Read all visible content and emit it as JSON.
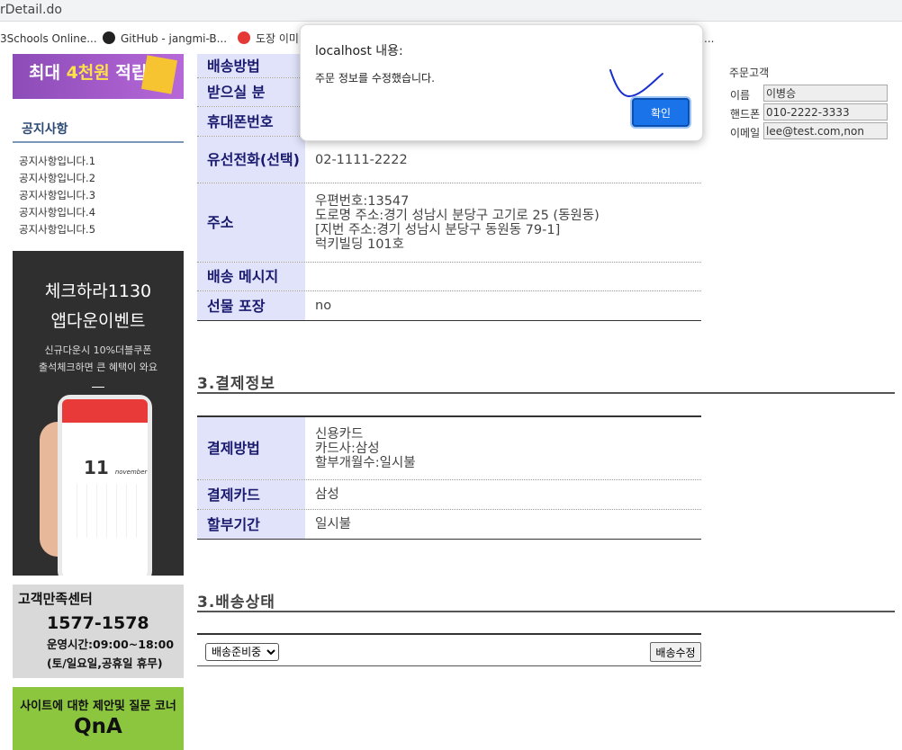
{
  "browser": {
    "url": "rDetail.do",
    "bookmarks": [
      {
        "label": "3Schools Online...",
        "icon": "w3schools-icon"
      },
      {
        "label": "GitHub - jangmi-B...",
        "icon": "github-icon"
      },
      {
        "label": "도장 이미",
        "icon": "stamp-icon"
      }
    ],
    "bookmark_trailing": "..."
  },
  "sidebar": {
    "top_banner": {
      "prefix": "최대 ",
      "highlight": "4천원",
      "suffix": " 적립!"
    },
    "notice": {
      "title": "공지사항",
      "items": [
        "공지사항입니다.1",
        "공지사항입니다.2",
        "공지사항입니다.3",
        "공지사항입니다.4",
        "공지사항입니다.5"
      ]
    },
    "app_banner": {
      "line1": "체크하라1130",
      "line2": "앱다운이벤트",
      "line3": "신규다운시 10%더블쿠폰",
      "line4": "출석체크하면 큰 혜택이 와요",
      "phone_day": "11",
      "phone_month": "november"
    },
    "customer_center": {
      "title": "고객만족센터",
      "phone": "1577-1578",
      "hours": "운영시간:09:00~18:00",
      "closed": "(토/일요일,공휴일 휴무)"
    },
    "qna": {
      "line1": "사이트에 대한 제안및 질문 코너",
      "line2": "QnA"
    }
  },
  "delivery_info": {
    "rows": [
      {
        "label": "배송방법",
        "lines": []
      },
      {
        "label": "받으실 분",
        "lines": []
      },
      {
        "label": "휴대폰번호",
        "lines": []
      },
      {
        "label": "유선전화(선택)",
        "lines": [
          "02-1111-2222"
        ]
      },
      {
        "label": "주소",
        "lines": [
          "우편번호:13547",
          "도로명 주소:경기 성남시 분당구 고기로 25 (동원동)",
          "[지번 주소:경기 성남시 분당구 동원동 79-1]",
          "럭키빌딩 101호"
        ]
      },
      {
        "label": "배송 메시지",
        "lines": []
      },
      {
        "label": "선물 포장",
        "lines": [
          "no"
        ]
      }
    ]
  },
  "payment": {
    "title": "3.결제정보",
    "rows": [
      {
        "label": "결제방법",
        "lines": [
          "신용카드",
          "카드사:삼성",
          "할부개월수:일시불"
        ]
      },
      {
        "label": "결제카드",
        "lines": [
          "삼성"
        ]
      },
      {
        "label": "할부기간",
        "lines": [
          "일시불"
        ]
      }
    ]
  },
  "shipping_status": {
    "title": "3.배송상태",
    "selected": "배송준비중",
    "button": "배송수정"
  },
  "customer": {
    "title": "주문고객",
    "name_label": "이름",
    "name": "이병승",
    "phone_label": "핸드폰",
    "phone": "010-2222-3333",
    "email_label": "이메일",
    "email": "lee@test.com,non"
  },
  "dialog": {
    "title": "localhost 내용:",
    "message": "주문 정보를 수정했습니다.",
    "ok": "확인"
  },
  "colors": {
    "header_bg": "#e1e3fb",
    "header_text": "#1a1a6e",
    "ok_button": "#1a73e8",
    "annotation_ink": "#1a2fd0"
  }
}
